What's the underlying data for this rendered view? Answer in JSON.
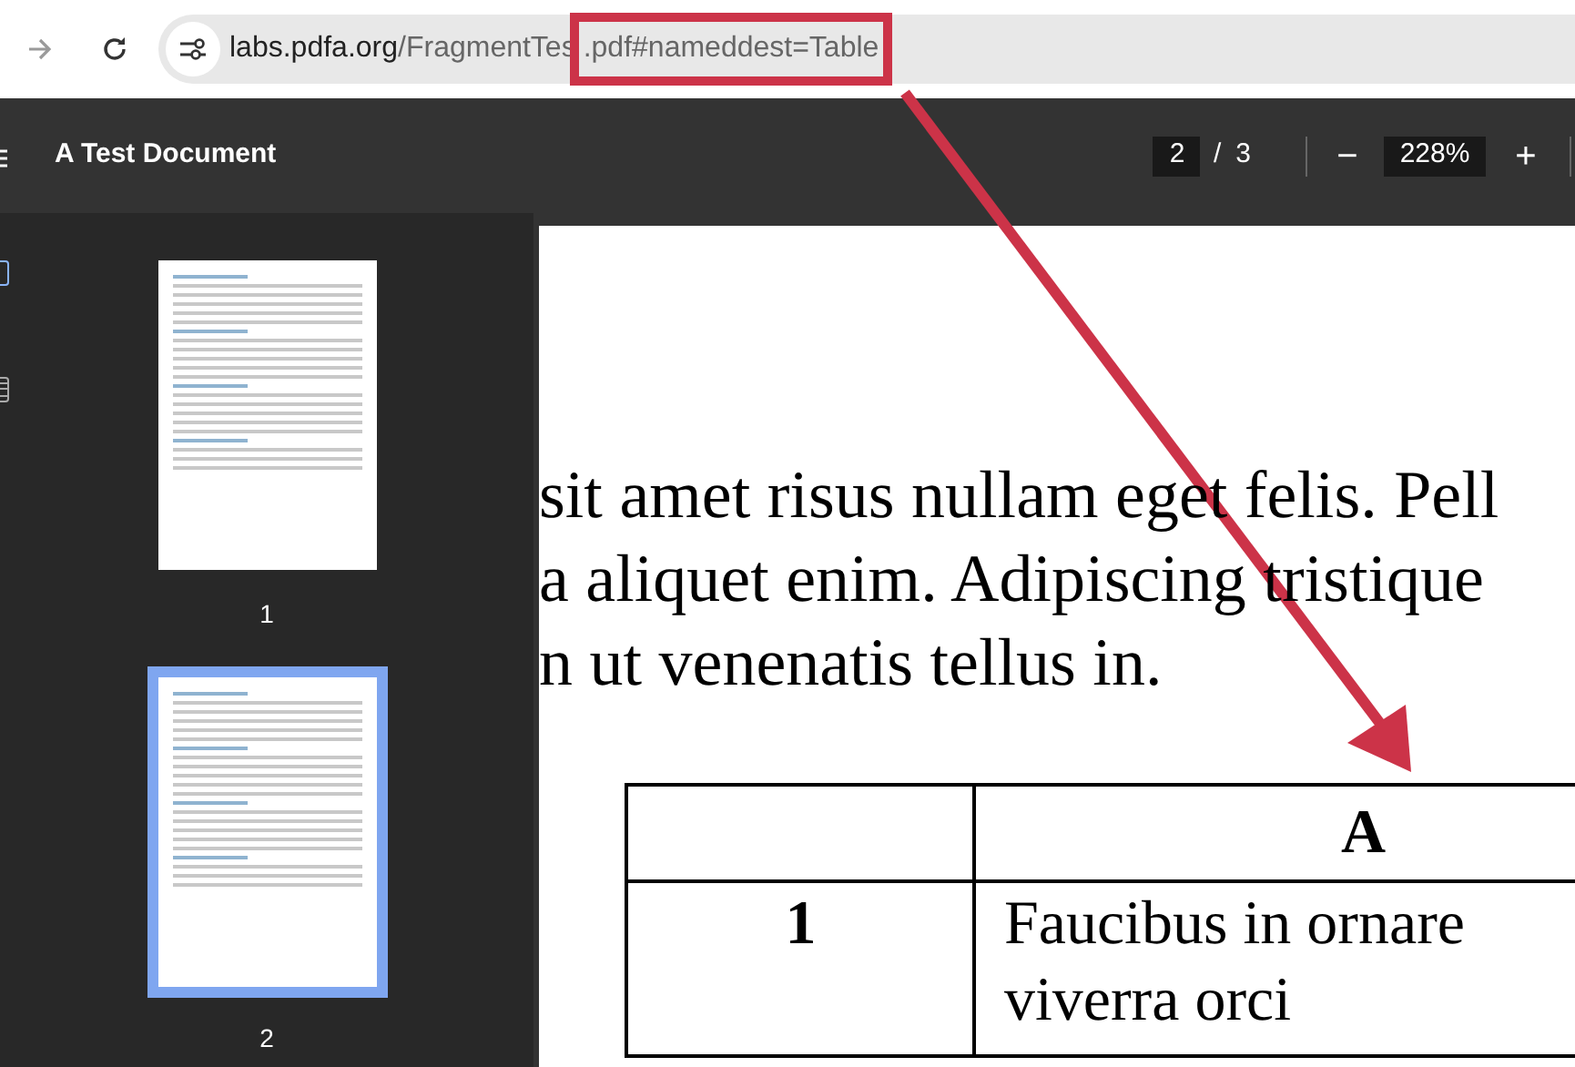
{
  "browser": {
    "url_host": "labs.pdfa.org",
    "url_path": "/FragmentTes",
    "url_fragment": ".pdf#nameddest=Table"
  },
  "viewer": {
    "title": "A Test Document",
    "page_current": "2",
    "page_separator": "/",
    "page_total": "3",
    "zoom_out": "−",
    "zoom": "228%",
    "zoom_in": "+"
  },
  "sidebar": {
    "views": [
      {
        "kind": "thumbnails",
        "selected": true
      },
      {
        "kind": "outline",
        "selected": false
      }
    ],
    "thumbnails": [
      {
        "label": "1",
        "selected": false
      },
      {
        "label": "2",
        "selected": true
      }
    ]
  },
  "document": {
    "paragraph_lines": [
      "sit amet risus nullam eget felis. Pell",
      "a aliquet enim. Adipiscing tristique",
      "n ut venenatis tellus in."
    ],
    "table": {
      "columns": [
        "",
        "A"
      ],
      "rows": [
        [
          "1",
          "Faucibus in ornare viverra orci"
        ]
      ]
    }
  }
}
